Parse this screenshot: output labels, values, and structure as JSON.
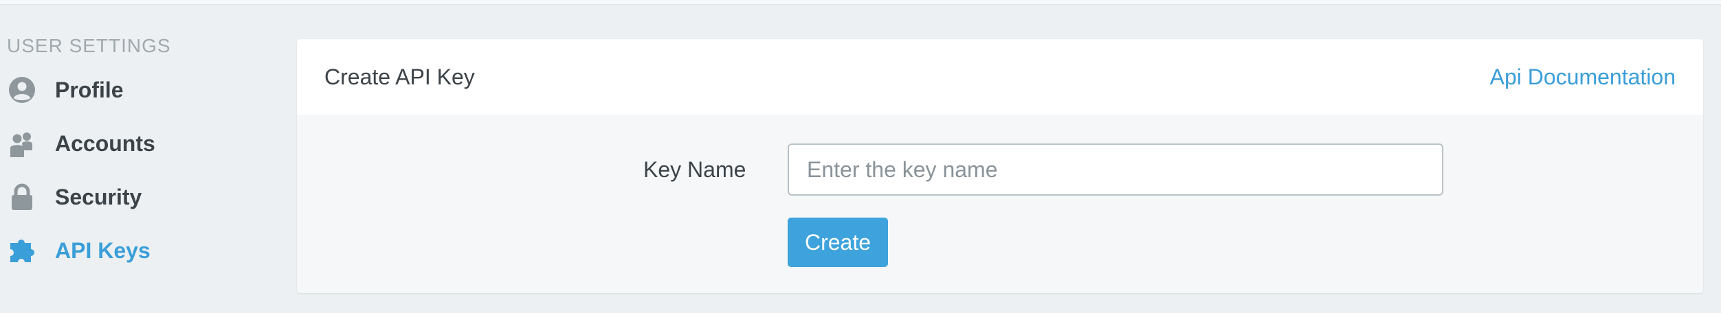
{
  "sidebar": {
    "heading": "USER SETTINGS",
    "items": [
      {
        "label": "Profile",
        "icon": "user-circle-icon",
        "active": false
      },
      {
        "label": "Accounts",
        "icon": "users-icon",
        "active": false
      },
      {
        "label": "Security",
        "icon": "lock-icon",
        "active": false
      },
      {
        "label": "API Keys",
        "icon": "puzzle-piece-icon",
        "active": true
      }
    ]
  },
  "card": {
    "title": "Create API Key",
    "doc_link": "Api Documentation",
    "form": {
      "key_label": "Key Name",
      "key_placeholder": "Enter the key name",
      "key_value": "",
      "create_label": "Create"
    }
  },
  "colors": {
    "accent": "#3a9ed8",
    "button": "#3ea2dc",
    "text": "#3c4348",
    "muted": "#a1a9ae",
    "icon": "#8e979c",
    "background": "#ecf0f2"
  }
}
